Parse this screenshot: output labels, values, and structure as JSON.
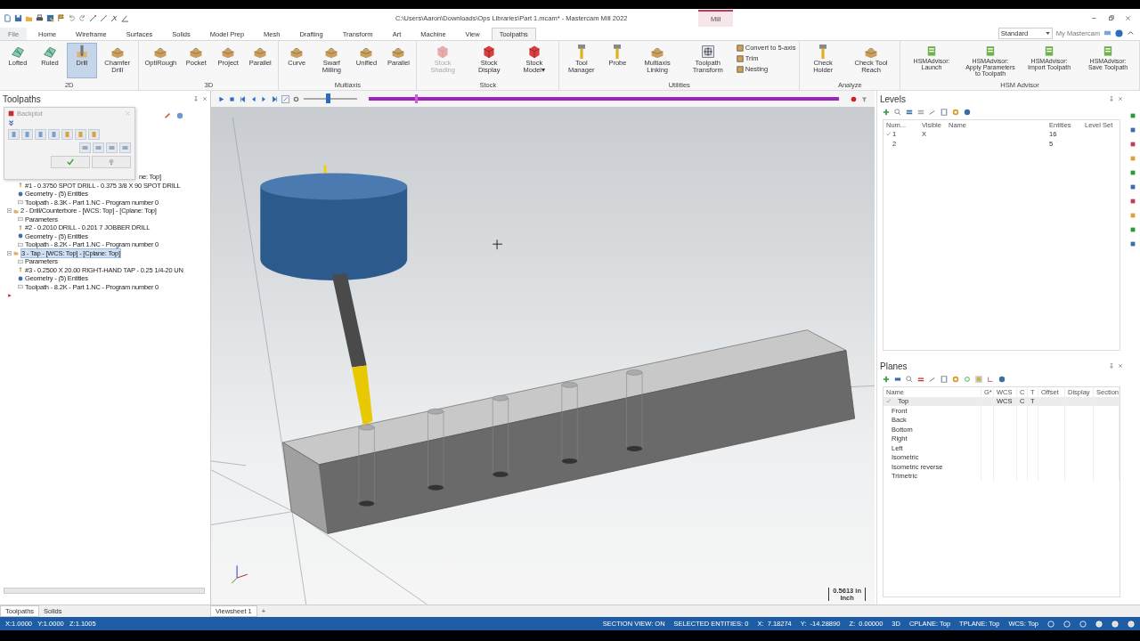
{
  "title_bar": {
    "title": "C:\\Users\\Aaron\\Downloads\\Ops Libraries\\Part 1.mcam* - Mastercam Mill 2022",
    "context_tab": "Mill"
  },
  "tabs": [
    {
      "label": "File",
      "selected": false
    },
    {
      "label": "Home",
      "selected": false
    },
    {
      "label": "Wireframe",
      "selected": false
    },
    {
      "label": "Surfaces",
      "selected": false
    },
    {
      "label": "Solids",
      "selected": false
    },
    {
      "label": "Model Prep",
      "selected": false
    },
    {
      "label": "Mesh",
      "selected": false
    },
    {
      "label": "Drafting",
      "selected": false
    },
    {
      "label": "Transform",
      "selected": false
    },
    {
      "label": "Art",
      "selected": false
    },
    {
      "label": "Machine",
      "selected": false
    },
    {
      "label": "View",
      "selected": false
    },
    {
      "label": "Toolpaths",
      "selected": true
    }
  ],
  "workspace": "Standard",
  "account_link": "My Mastercam",
  "ribbon": [
    {
      "name": "2D",
      "buttons": [
        {
          "label": "Lofted",
          "kind": "mesh",
          "selected": false,
          "disabled": false
        },
        {
          "label": "Ruled",
          "kind": "mesh",
          "selected": false,
          "disabled": false
        },
        {
          "label": "Drill",
          "kind": "drill",
          "selected": true,
          "disabled": false
        },
        {
          "label": "Chamfer Drill",
          "kind": "block",
          "selected": false,
          "disabled": false
        }
      ]
    },
    {
      "name": "3D",
      "buttons": [
        {
          "label": "OptiRough",
          "kind": "block",
          "selected": false,
          "disabled": false
        },
        {
          "label": "Pocket",
          "kind": "block",
          "selected": false,
          "disabled": false
        },
        {
          "label": "Project",
          "kind": "block",
          "selected": false,
          "disabled": false
        },
        {
          "label": "Parallel",
          "kind": "block",
          "selected": false,
          "disabled": false
        }
      ]
    },
    {
      "name": "Multiaxis",
      "buttons": [
        {
          "label": "Curve",
          "kind": "block",
          "selected": false,
          "disabled": false
        },
        {
          "label": "Swarf Milling",
          "kind": "block",
          "selected": false,
          "disabled": false
        },
        {
          "label": "Unified",
          "kind": "block",
          "selected": false,
          "disabled": false
        },
        {
          "label": "Parallel",
          "kind": "block",
          "selected": false,
          "disabled": false
        }
      ]
    },
    {
      "name": "Stock",
      "buttons": [
        {
          "label": "Stock Shading",
          "kind": "cube",
          "selected": false,
          "disabled": true
        },
        {
          "label": "Stock Display",
          "kind": "cube",
          "selected": false,
          "disabled": false
        },
        {
          "label": "Stock Model▾",
          "kind": "cube",
          "selected": false,
          "disabled": false
        }
      ]
    },
    {
      "name": "Utilities",
      "buttons": [
        {
          "label": "Tool Manager",
          "kind": "tool",
          "selected": false,
          "disabled": false
        },
        {
          "label": "Probe",
          "kind": "tool",
          "selected": false,
          "disabled": false
        },
        {
          "label": "Multiaxis Linking",
          "kind": "block",
          "selected": false,
          "disabled": false
        },
        {
          "label": "Toolpath Transform",
          "kind": "frame",
          "selected": false,
          "disabled": false
        },
        {
          "label": "Convert to 5-axis",
          "kind": "small",
          "selected": false,
          "disabled": false
        },
        {
          "label": "Trim",
          "kind": "small",
          "selected": false,
          "disabled": false
        },
        {
          "label": "Nesting",
          "kind": "small",
          "selected": false,
          "disabled": false
        }
      ]
    },
    {
      "name": "Analyze",
      "buttons": [
        {
          "label": "Check Holder",
          "kind": "tool",
          "selected": false,
          "disabled": false
        },
        {
          "label": "Check Tool Reach",
          "kind": "block",
          "selected": false,
          "disabled": false
        }
      ]
    },
    {
      "name": "HSM Advisor",
      "buttons": [
        {
          "label": "HSMAdvisor: Launch",
          "kind": "doc",
          "selected": false,
          "disabled": false
        },
        {
          "label": "HSMAdvisor: Apply Parameters to Toolpath",
          "kind": "doc",
          "selected": false,
          "disabled": false
        },
        {
          "label": "HSMAdvisor: Import Toolpath",
          "kind": "doc",
          "selected": false,
          "disabled": false
        },
        {
          "label": "HSMAdvisor: Save Toolpath",
          "kind": "doc",
          "selected": false,
          "disabled": false
        }
      ]
    }
  ],
  "toolpaths": {
    "title": "Toolpaths",
    "backplot_title": "Backplot",
    "operations": [
      {
        "label": "ne: Top]",
        "selected": false,
        "children": [
          {
            "kind": "tool",
            "label": "#1 - 0.3750 SPOT DRILL - 0.375 3/8 X 90 SPOT DRILL"
          },
          {
            "kind": "geometry",
            "label": "Geometry - (5) Entities"
          },
          {
            "kind": "toolpath",
            "label": "Toolpath - 8.3K - Part 1.NC - Program number 0"
          }
        ]
      },
      {
        "label": "2 - Drill/Counterbore - [WCS: Top] - [Cplane: Top]",
        "selected": false,
        "children": [
          {
            "kind": "params",
            "label": "Parameters"
          },
          {
            "kind": "tool",
            "label": "#2 - 0.2010 DRILL - 0.201 7 JOBBER DRILL"
          },
          {
            "kind": "geometry",
            "label": "Geometry - (5) Entities"
          },
          {
            "kind": "toolpath",
            "label": "Toolpath - 8.2K - Part 1.NC - Program number 0"
          }
        ]
      },
      {
        "label": "3 - Tap - [WCS: Top] - [Cplane: Top]",
        "selected": true,
        "children": [
          {
            "kind": "params",
            "label": "Parameters"
          },
          {
            "kind": "tool",
            "label": "#3 - 0.2500 X 20.00 RIGHT-HAND TAP - 0.25 1/4-20 UN"
          },
          {
            "kind": "geometry",
            "label": "Geometry - (5) Entities"
          },
          {
            "kind": "toolpath",
            "label": "Toolpath - 8.2K - Part 1.NC - Program number 0"
          }
        ]
      }
    ]
  },
  "playback": {
    "speed": {
      "level": 0.45
    },
    "position": {
      "level": 0.1
    }
  },
  "viewport": {
    "scale": "0.5613 in",
    "units": "Inch"
  },
  "levels": {
    "title": "Levels",
    "columns": [
      "Num...",
      "Visible",
      "Name",
      "Entities",
      "Level Set"
    ],
    "rows": [
      {
        "number": "1",
        "active": true,
        "visible": "X",
        "entities": "16"
      },
      {
        "number": "2",
        "active": false,
        "entities": "5"
      }
    ]
  },
  "planes": {
    "title": "Planes",
    "columns": [
      "Name",
      "G*",
      "WCS",
      "C",
      "T",
      "Offset",
      "Display",
      "Section"
    ],
    "rows": [
      {
        "name": "Top",
        "selected": true,
        "wcs": "WCS",
        "c": "C",
        "t": "T"
      },
      {
        "name": "Front",
        "selected": false
      },
      {
        "name": "Back",
        "selected": false
      },
      {
        "name": "Bottom",
        "selected": false
      },
      {
        "name": "Right",
        "selected": false
      },
      {
        "name": "Left",
        "selected": false
      },
      {
        "name": "Isometric",
        "selected": false
      },
      {
        "name": "Isometric reverse",
        "selected": false
      },
      {
        "name": "Trimetric",
        "selected": false
      }
    ]
  },
  "panel_tabs": [
    {
      "label": "Toolpaths",
      "selected": true
    },
    {
      "label": "Solids",
      "selected": false
    }
  ],
  "viewsheets": [
    {
      "label": "Viewsheet 1",
      "selected": true
    }
  ],
  "add_sheet": "+",
  "status_bar": {
    "left": "X:1.0000   Y:1.0000   Z:1.1005",
    "items": [
      "SECTION VIEW: ON",
      "SELECTED ENTITIES: 0",
      "X:  7.18274",
      "Y:  -14.28890",
      "Z:  0.00000",
      "3D",
      "CPLANE: Top",
      "TPLANE: Top",
      "WCS: Top"
    ]
  }
}
